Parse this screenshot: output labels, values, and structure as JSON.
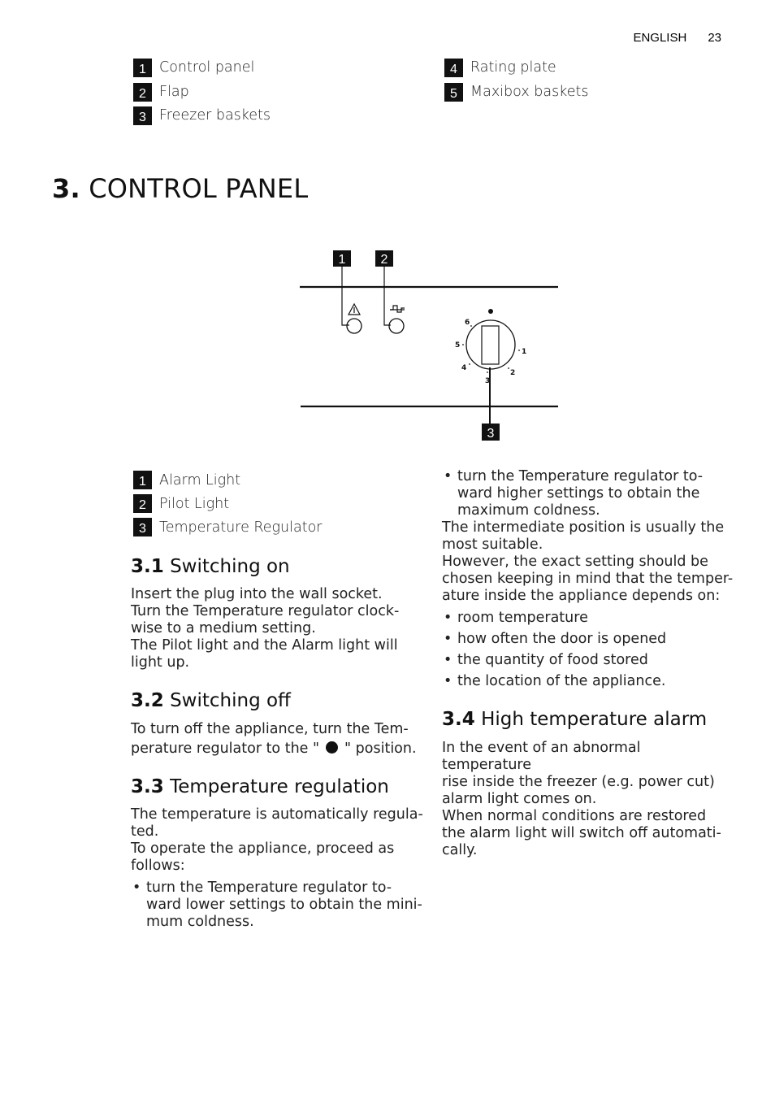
{
  "header": {
    "language": "ENGLISH",
    "page_number": "23"
  },
  "parts_legend": {
    "left": [
      {
        "num": "1",
        "label": "Control panel"
      },
      {
        "num": "2",
        "label": "Flap"
      },
      {
        "num": "3",
        "label": "Freezer baskets"
      }
    ],
    "right": [
      {
        "num": "4",
        "label": "Rating plate"
      },
      {
        "num": "5",
        "label": "Maxibox baskets"
      }
    ]
  },
  "chapter": {
    "number": "3.",
    "title": "CONTROL PANEL"
  },
  "diagram": {
    "callouts": [
      "1",
      "2",
      "3"
    ],
    "dial_marks": [
      "1",
      "2",
      "3",
      "4",
      "5",
      "6"
    ],
    "icons": [
      "alarm-warning-triangle",
      "pilot-plug",
      "off-dot"
    ]
  },
  "panel_legend": [
    {
      "num": "1",
      "label": "Alarm Light"
    },
    {
      "num": "2",
      "label": "Pilot Light"
    },
    {
      "num": "3",
      "label": "Temperature Regulator"
    }
  ],
  "sections": {
    "s31": {
      "number": "3.1",
      "title": "Switching on",
      "lines": [
        "Insert the plug into the wall socket.",
        "Turn the Temperature regulator clock-",
        "wise to a medium setting.",
        "The Pilot light and the Alarm light will",
        "light up."
      ]
    },
    "s32": {
      "number": "3.2",
      "title": "Switching off",
      "line1": "To turn off the appliance, turn the Tem-",
      "line2_before": "perature regulator to the \"",
      "line2_after": "\" position."
    },
    "s33": {
      "number": "3.3",
      "title": "Temperature regulation",
      "lines": [
        "The temperature is automatically regula-",
        "ted.",
        "To operate the appliance, proceed as",
        "follows:"
      ],
      "bullet1": [
        "turn the Temperature regulator to-",
        "ward lower settings to obtain the mini-",
        "mum coldness."
      ],
      "bullet2": [
        "turn the Temperature regulator to-",
        "ward higher settings to obtain the",
        "maximum coldness."
      ],
      "after_lines": [
        "The intermediate position is usually the",
        "most suitable.",
        "However, the exact setting should be",
        "chosen keeping in mind that the temper-",
        "ature inside the appliance depends on:"
      ],
      "factors": [
        "room temperature",
        "how often the door is opened",
        "the quantity of food stored",
        "the location of the appliance."
      ]
    },
    "s34": {
      "number": "3.4",
      "title": "High temperature alarm",
      "lines": [
        "In the event of an abnormal temperature",
        "rise inside the freezer (e.g. power cut)",
        "alarm light comes on.",
        "When normal conditions are restored",
        "the alarm light will switch off automati-",
        "cally."
      ]
    }
  },
  "bullet_glyph": "•"
}
